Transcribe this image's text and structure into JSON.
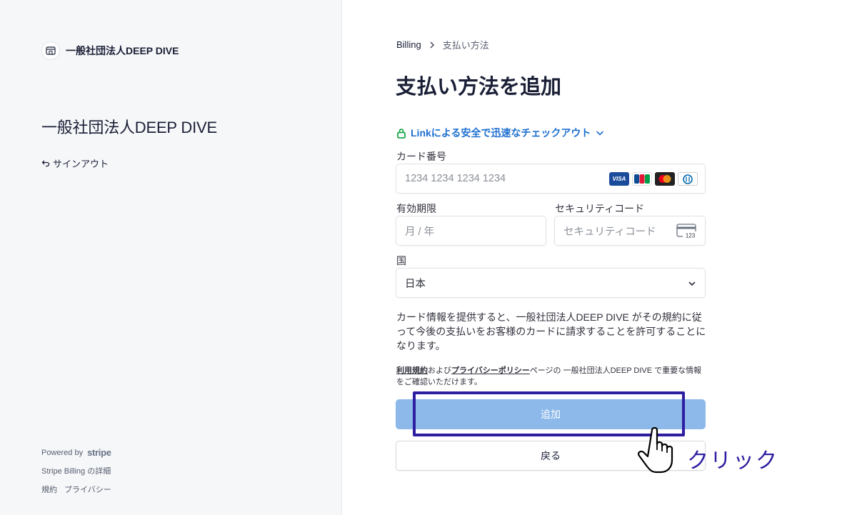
{
  "sidebar": {
    "brand_name": "一般社団法人DEEP DIVE",
    "org_title": "一般社団法人DEEP DIVE",
    "signout_label": "サインアウト",
    "powered_by": "Powered by",
    "stripe_word": "stripe",
    "billing_details": "Stripe Billing の詳細",
    "terms_link": "規約",
    "privacy_link": "プライバシー"
  },
  "breadcrumb": {
    "parent": "Billing",
    "current": "支払い方法"
  },
  "page_title": "支払い方法を追加",
  "link_checkout": "Linkによる安全で迅速なチェックアウト",
  "form": {
    "card_number_label": "カード番号",
    "card_number_placeholder": "1234 1234 1234 1234",
    "expiry_label": "有効期限",
    "expiry_placeholder": "月 / 年",
    "cvc_label": "セキュリティコード",
    "cvc_placeholder": "セキュリティコード",
    "cvc_icon_text": "123",
    "country_label": "国",
    "country_value": "日本",
    "card_brands": [
      "VISA",
      "JCB",
      "Mastercard",
      "Diners"
    ]
  },
  "terms_text": "カード情報を提供すると、一般社団法人DEEP DIVE がその規約に従って今後の支払いをお客様のカードに請求することを許可することになります。",
  "legal": {
    "terms": "利用規約",
    "and": "および",
    "privacy": "プライバシーポリシー",
    "rest": "ページの 一般社団法人DEEP DIVE で重要な情報をご確認いただけます。"
  },
  "buttons": {
    "add": "追加",
    "back": "戻る"
  },
  "annotation": {
    "click_label": "クリック",
    "color": "#2e1fa0"
  },
  "colors": {
    "link_blue": "#1e6fd0",
    "add_button": "#8cb8ea",
    "lock_green": "#1aa84a"
  }
}
